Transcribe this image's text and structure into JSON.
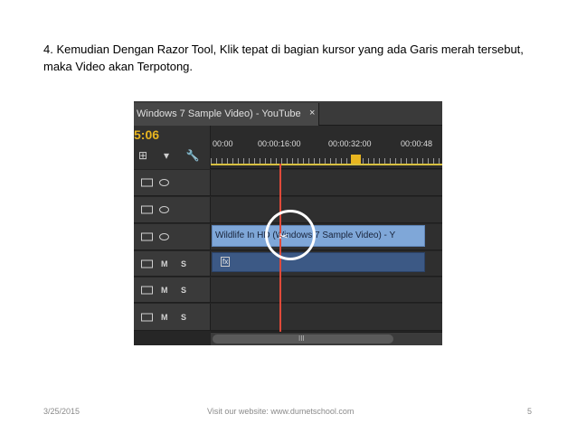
{
  "instruction": "4. Kemudian Dengan Razor Tool, Klik tepat di bagian kursor yang ada Garis merah tersebut, maka Video akan Terpotong.",
  "screenshot": {
    "tab_title": "Windows 7 Sample Video) - YouTube",
    "tab_close": "×",
    "timecode": "5:06",
    "timeline_ticks": [
      "00:00",
      "00:00:16:00",
      "00:00:32:00",
      "00:00:48"
    ],
    "video_clip_label": "Wildlife In HD (Windows 7 Sample Video) - Y",
    "audio_clip_badge": "fx",
    "track_letters": {
      "mute": "M",
      "solo": "S"
    },
    "scroll_grip": "III"
  },
  "footer": {
    "date": "3/25/2015",
    "website": "Visit our website: www.dumetschool.com",
    "page_number": "5"
  },
  "colors": {
    "playhead": "#e04a3a",
    "timecode": "#e8b520",
    "video_clip": "#7fa7d8",
    "audio_clip": "#3c5985"
  },
  "icons": [
    "camera-icon",
    "eye-icon",
    "wrench-icon",
    "snap-icon",
    "marker-icon",
    "razor-icon"
  ]
}
